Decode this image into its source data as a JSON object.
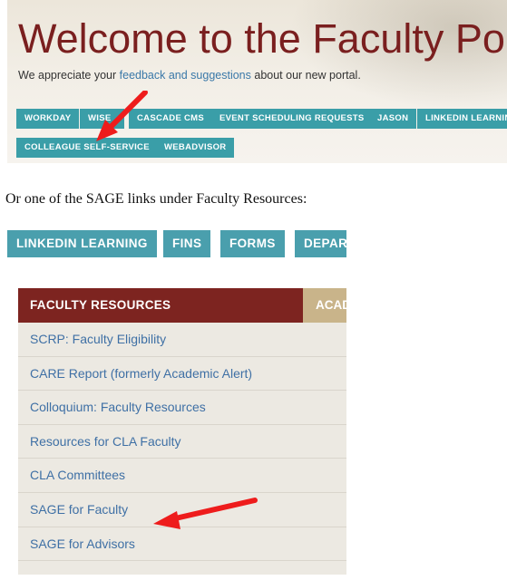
{
  "banner": {
    "title": "Welcome to the Faculty Portal",
    "subtitle_prefix": "We appreciate your ",
    "subtitle_link": "feedback and suggestions",
    "subtitle_suffix": " about our new portal.",
    "buttons_row1": [
      "WORKDAY",
      "WISE",
      "CASCADE CMS",
      "EVENT SCHEDULING REQUESTS",
      "JASON",
      "LINKEDIN LEARNING"
    ],
    "buttons_row2": [
      "COLLEAGUE SELF-SERVICE",
      "WEBADVISOR"
    ]
  },
  "caption": "Or one of the SAGE links under Faculty Resources:",
  "nav": {
    "items": [
      "LINKEDIN LEARNING",
      "FINS",
      "FORMS",
      "DEPARTMENTS"
    ]
  },
  "panel": {
    "active_tab": "FACULTY RESOURCES",
    "next_tab": "ACADEMIC",
    "links": [
      "SCRP: Faculty Eligibility",
      "CARE Report (formerly Academic Alert)",
      "Colloquium: Faculty Resources",
      "Resources for CLA Faculty",
      "CLA Committees",
      "SAGE for Faculty",
      "SAGE for Advisors"
    ]
  },
  "colors": {
    "title_red": "#7a1f1f",
    "button_teal": "#3a9ea8",
    "tab_maroon": "#7d2420",
    "tab_tan": "#c9b48a",
    "arrow_red": "#ee1c1c",
    "link_blue": "#3f70a5"
  }
}
